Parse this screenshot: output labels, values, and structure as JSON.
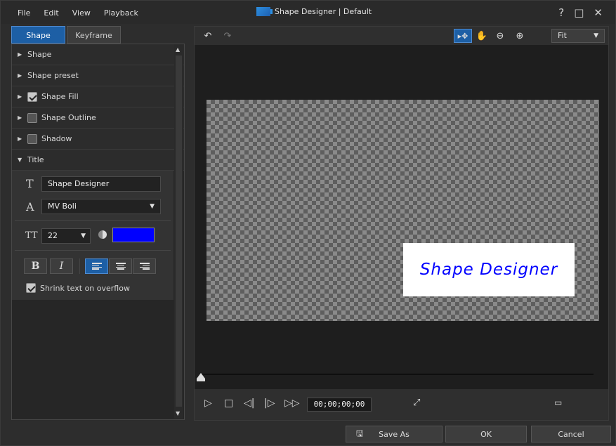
{
  "menu": {
    "file": "File",
    "edit": "Edit",
    "view": "View",
    "playback": "Playback"
  },
  "app": {
    "title": "Shape Designer | Default"
  },
  "window_controls": {
    "help": "?",
    "maximize": "□",
    "close": "✕"
  },
  "tabs": {
    "shape": "Shape",
    "keyframe": "Keyframe"
  },
  "sections": {
    "shape": "Shape",
    "shape_preset": "Shape preset",
    "shape_fill": "Shape Fill",
    "shape_outline": "Shape Outline",
    "shadow": "Shadow",
    "title": "Title"
  },
  "section_state": {
    "shape_fill_checked": true,
    "shape_outline_checked": false,
    "shadow_checked": false
  },
  "title_panel": {
    "text_value": "Shape Designer",
    "font_value": "MV Boli",
    "size_value": "22",
    "text_color": "#0000ff",
    "bold_label": "B",
    "italic_label": "I",
    "shrink_label": "Shrink text on overflow",
    "shrink_checked": true,
    "icons": {
      "text": "T",
      "font": "A",
      "size": "TT"
    }
  },
  "toolbar": {
    "zoom_value": "Fit"
  },
  "canvas": {
    "title_text": "Shape Designer"
  },
  "transport": {
    "timecode": "00;00;00;00"
  },
  "buttons": {
    "save_as": "Save As",
    "ok": "OK",
    "cancel": "Cancel"
  },
  "colors": {
    "accent": "#1d5fa5",
    "text_color": "#0000ff"
  }
}
